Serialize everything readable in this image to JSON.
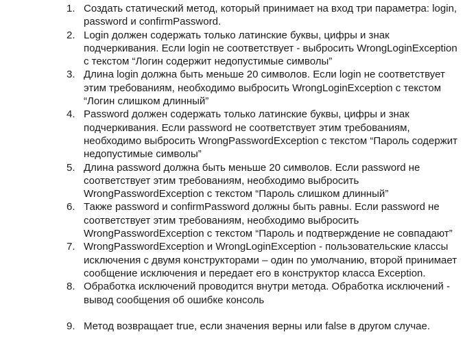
{
  "list": {
    "items": [
      {
        "num": "1.",
        "text": "Создать статический метод, который принимает на вход три параметра: login, password и confirmPassword."
      },
      {
        "num": "2.",
        "text": "Login должен содержать только латинские буквы, цифры и знак подчеркивания. Если login не соответствует - выбросить WrongLoginException с текстом “Логин содержит недопустимые символы”"
      },
      {
        "num": "3.",
        "text": "Длина login должна быть меньше 20 символов. Если login не соответствует этим требованиям, необходимо выбросить WrongLoginException с текстом “Логин слишком длинный”"
      },
      {
        "num": "4.",
        "text": "Password должен содержать только латинские буквы, цифры и знак подчеркивания. Если password не соответствует этим требованиям, необходимо выбросить WrongPasswordException с текстом “Пароль содержит недопустимые символы”"
      },
      {
        "num": "5.",
        "text": "Длина password должна быть меньше 20 символов. Если password не соответствует этим требованиям, необходимо выбросить WrongPasswordException с текстом “Пароль слишком длинный”"
      },
      {
        "num": "6.",
        "text": "Также password и confirmPassword должны быть равны. Если password не соответствует этим требованиям, необходимо выбросить WrongPasswordException с текстом “Пароль и подтверждение не совпадают”"
      },
      {
        "num": "7.",
        "text": "WrongPasswordException и WrongLoginException - пользовательские классы исключения с двумя конструкторами – один по умолчанию, второй принимает сообщение исключения и передает его в конструктор класса Exception."
      },
      {
        "num": "8.",
        "text": "Обработка исключений проводится внутри метода. Обработка исключений - вывод сообщения об ошибке консоль"
      },
      {
        "num": "9.",
        "text": "Метод возвращает true, если значения верны или false в другом случае."
      }
    ]
  }
}
